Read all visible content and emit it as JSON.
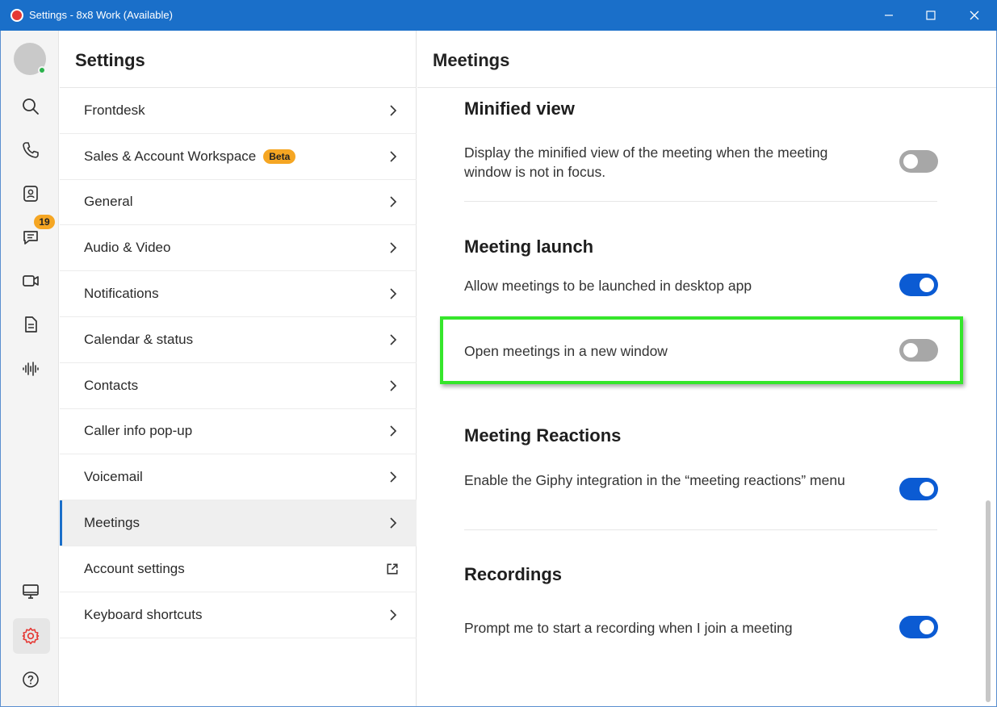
{
  "window": {
    "title": "Settings - 8x8 Work (Available)",
    "minimize_glyph": "–",
    "maximize_glyph": "☐",
    "close_glyph": "✕"
  },
  "rail": {
    "badge_count": "19",
    "icons": [
      "search-icon",
      "phone-icon",
      "contacts-icon",
      "chat-icon",
      "video-icon",
      "document-icon",
      "voicemail-icon",
      "desktop-icon",
      "settings-icon",
      "help-icon"
    ]
  },
  "nav": {
    "title": "Settings",
    "items": [
      {
        "label": "Frontdesk"
      },
      {
        "label": "Sales & Account Workspace",
        "badge": "Beta"
      },
      {
        "label": "General"
      },
      {
        "label": "Audio & Video"
      },
      {
        "label": "Notifications"
      },
      {
        "label": "Calendar & status"
      },
      {
        "label": "Contacts"
      },
      {
        "label": "Caller info pop-up"
      },
      {
        "label": "Voicemail"
      },
      {
        "label": "Meetings",
        "active": true
      },
      {
        "label": "Account settings",
        "external": true
      },
      {
        "label": "Keyboard shortcuts"
      }
    ]
  },
  "content": {
    "title": "Meetings",
    "sections": {
      "minified": {
        "title": "Minified view",
        "row": {
          "text": "Display the minified view of the meeting when the meeting window is not in focus.",
          "enabled": false
        }
      },
      "launch": {
        "title": "Meeting launch",
        "row1": {
          "text": "Allow meetings to be launched in desktop app",
          "enabled": true
        },
        "row2": {
          "text": "Open meetings in a new window",
          "enabled": false
        }
      },
      "reactions": {
        "title": "Meeting Reactions",
        "row": {
          "text": "Enable the Giphy integration in the “meeting reactions” menu",
          "enabled": true
        }
      },
      "recordings": {
        "title": "Recordings",
        "row": {
          "text": "Prompt me to start a recording when I join a meeting",
          "enabled": true
        }
      }
    }
  },
  "colors": {
    "titlebar": "#1a6fc9",
    "toggle_on": "#0b5bd3",
    "toggle_off": "#a7a7a7",
    "badge": "#f5a623",
    "highlight": "#35e62b",
    "settings_icon_active": "#e53935"
  }
}
